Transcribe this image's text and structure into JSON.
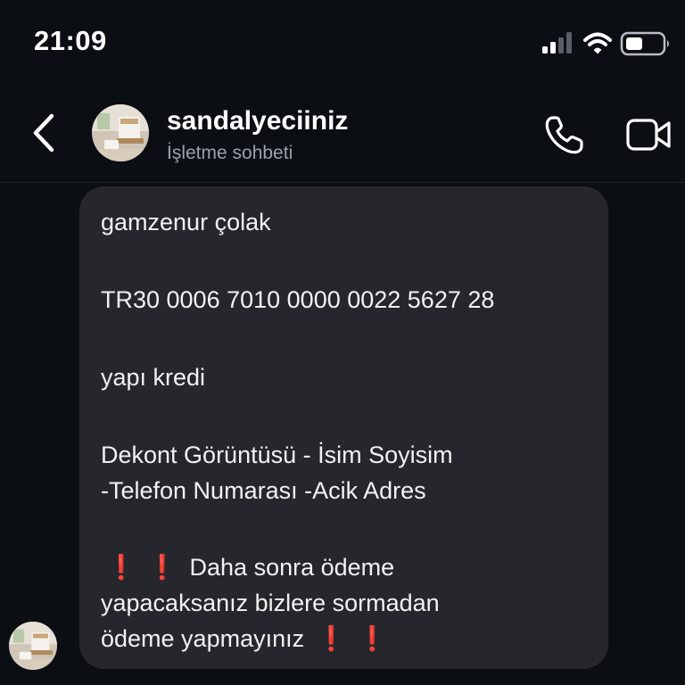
{
  "status_bar": {
    "time": "21:09",
    "icons": [
      "cellular-signal-icon",
      "wifi-icon",
      "battery-icon"
    ]
  },
  "header": {
    "contact_name": "sandalyeciiniz",
    "subtitle": "İşletme sohbeti",
    "icons": [
      "back-chevron-icon",
      "phone-icon",
      "video-camera-icon"
    ]
  },
  "message": {
    "name": "gamzenur çolak",
    "iban": "TR30 0006 7010 0000 0022 5627 28",
    "bank": "yapı kredi",
    "instructions_line1": "Dekont Görüntüsü - İsim Soyisim",
    "instructions_line2": "-Telefon Numarası -Acik Adres",
    "warning_line1": "Daha sonra ödeme",
    "warning_line2": "yapacaksanız bizlere sormadan",
    "warning_line3": "ödeme yapmayınız",
    "warning_emoji": "❗"
  },
  "colors": {
    "background": "#0b0f14",
    "bubble": "#25272c",
    "text": "#f2f2f2",
    "subtitle": "#9ba1aa",
    "warning": "#e0202a"
  }
}
